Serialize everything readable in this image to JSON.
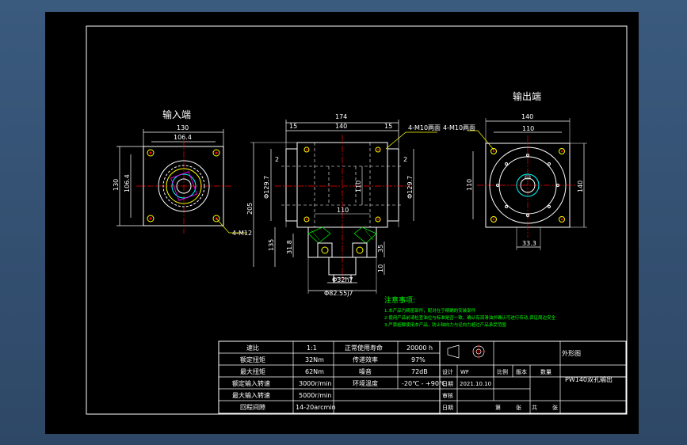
{
  "views": {
    "input_end_label": "输入端",
    "output_end_label": "输出端"
  },
  "input_view_dims": {
    "top_outer": "130",
    "top_inner": "106.4",
    "left_outer": "130",
    "left_inner": "106.4",
    "holes": "4-M12"
  },
  "front_view_dims": {
    "overall": "174",
    "left_step": "15",
    "center": "140",
    "right_step": "15",
    "holes": "4-M10两面",
    "d_left": "2",
    "d_right": "2",
    "dia_left": "Φ129.7",
    "height": "205",
    "inner_110": "110",
    "horiz_110": "110",
    "dia_right": "Φ129.7",
    "lower_135": "135",
    "lower_31": "31.8",
    "lower_35": "35",
    "lower_10": "10",
    "shaft_dia": "Φ32h7",
    "flange_dia": "Φ82.55j7"
  },
  "output_view_dims": {
    "top_outer": "140",
    "top_inner": "110",
    "holes": "4-M10两面",
    "left_110": "110",
    "right_140": "140",
    "bottom": "33.3"
  },
  "notes": {
    "title": "注意事项:",
    "lines": [
      "1.本产品为精密部件，配对在于精确的安装部件",
      "2.使用产品前请检查油位与标准是否一致，确认有润滑油并确认可进行传动,保证周边安全",
      "3.严禁超载使用本产品，防止轴向力与径向力超过产品承受范围"
    ]
  },
  "title_block": {
    "spec_rows": [
      [
        "速比",
        "1:1",
        "正常使用寿命",
        "20000 h"
      ],
      [
        "额定扭矩",
        "32Nm",
        "传递效率",
        "97%"
      ],
      [
        "最大扭矩",
        "62Nm",
        "噪音",
        "72dB"
      ],
      [
        "额定输入转速",
        "3000r/min",
        "环境温度",
        "-20℃ - +90℃"
      ],
      [
        "最大输入转速",
        "5000r/min",
        "",
        ""
      ],
      [
        "回程间隙",
        "14-20arcmin",
        "",
        ""
      ]
    ],
    "drawing_type": "外形图",
    "model": "PW140双孔输出",
    "design_label": "设计",
    "designer": "WF",
    "date_label": "日期",
    "date": "2021.10.10",
    "review_label": "审核",
    "scale_label": "比例",
    "version_label": "版本",
    "quantity_label": "数量",
    "sheet_label": "第",
    "sheet_mid": "张",
    "sheet_total": "共",
    "sheet_end": "张"
  },
  "colors": {
    "background": "#000000",
    "outline": "#ffffff",
    "centerline": "#ff0000",
    "hidden": "#ffffff",
    "feature": "#ffff00",
    "hatch": "#00ff00",
    "label_green": "#00ff00",
    "bore": "#00ffff"
  }
}
